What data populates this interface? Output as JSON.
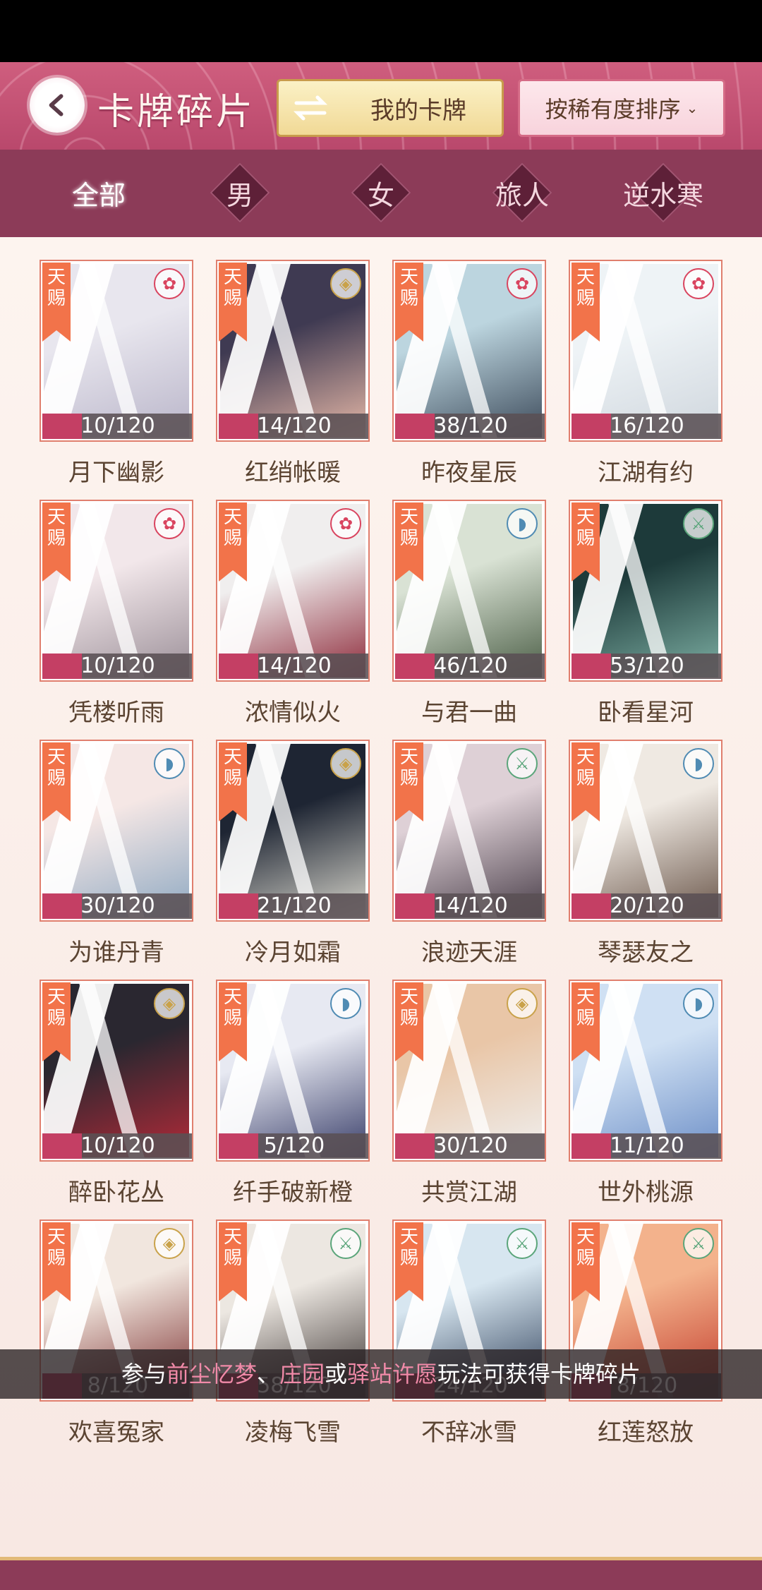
{
  "header": {
    "title": "卡牌碎片",
    "mycards_label": "我的卡牌",
    "sort_label": "按稀有度排序"
  },
  "filters": [
    "全部",
    "男",
    "女",
    "旅人",
    "逆水寒"
  ],
  "active_filter": "全部",
  "colors": {
    "accent": "#c43f64",
    "header": "#cf5e7e",
    "filter_bg": "#8c3b58",
    "tag": "#f2734a"
  },
  "cards": [
    {
      "tag": "天赐",
      "count": "10/120",
      "name": "月下幽影",
      "badge": "flower-icon",
      "art": [
        "#e8e6ee",
        "#b9b5c9"
      ]
    },
    {
      "tag": "天赐",
      "count": "14/120",
      "name": "红绡帐暖",
      "badge": "coin-icon",
      "art": [
        "#3f3a52",
        "#e7b9a8"
      ]
    },
    {
      "tag": "天赐",
      "count": "38/120",
      "name": "昨夜星辰",
      "badge": "flower-icon",
      "art": [
        "#bcd5df",
        "#3c4a5a"
      ]
    },
    {
      "tag": "天赐",
      "count": "16/120",
      "name": "江湖有约",
      "badge": "flower-icon",
      "art": [
        "#eef3f6",
        "#cfd6dd"
      ]
    },
    {
      "tag": "天赐",
      "count": "10/120",
      "name": "凭楼听雨",
      "badge": "flower-icon",
      "art": [
        "#f2e7ea",
        "#9b8f98"
      ]
    },
    {
      "tag": "天赐",
      "count": "14/120",
      "name": "浓情似火",
      "badge": "flower-icon",
      "art": [
        "#f0eeee",
        "#8e2b3b"
      ]
    },
    {
      "tag": "天赐",
      "count": "46/120",
      "name": "与君一曲",
      "badge": "fan-icon",
      "art": [
        "#d9e2d4",
        "#4b5e46"
      ]
    },
    {
      "tag": "天赐",
      "count": "53/120",
      "name": "卧看星河",
      "badge": "sword-icon",
      "art": [
        "#1d3a3a",
        "#7eb0a4"
      ]
    },
    {
      "tag": "天赐",
      "count": "30/120",
      "name": "为谁丹青",
      "badge": "fan-icon",
      "art": [
        "#f5e7e5",
        "#8fa9c2"
      ]
    },
    {
      "tag": "天赐",
      "count": "21/120",
      "name": "冷月如霜",
      "badge": "coin-icon",
      "art": [
        "#1e2533",
        "#d8d6cc"
      ]
    },
    {
      "tag": "天赐",
      "count": "14/120",
      "name": "浪迹天涯",
      "badge": "sword-icon",
      "art": [
        "#ded0d6",
        "#4a3f4a"
      ]
    },
    {
      "tag": "天赐",
      "count": "20/120",
      "name": "琴瑟友之",
      "badge": "fan-icon",
      "art": [
        "#efe9e2",
        "#6b574b"
      ]
    },
    {
      "tag": "天赐",
      "count": "10/120",
      "name": "醉卧花丛",
      "badge": "coin-icon",
      "art": [
        "#2a2730",
        "#b32a38"
      ]
    },
    {
      "tag": "天赐",
      "count": "5/120",
      "name": "纤手破新橙",
      "badge": "fan-icon",
      "art": [
        "#e7e9f2",
        "#3a3f6a"
      ]
    },
    {
      "tag": "天赐",
      "count": "30/120",
      "name": "共赏江湖",
      "badge": "coin-icon",
      "art": [
        "#e9c6a7",
        "#efefef"
      ]
    },
    {
      "tag": "天赐",
      "count": "11/120",
      "name": "世外桃源",
      "badge": "fan-icon",
      "art": [
        "#cfe0f3",
        "#6d8fc7"
      ]
    },
    {
      "tag": "天赐",
      "count": "8/120",
      "name": "欢喜冤家",
      "badge": "coin-icon",
      "art": [
        "#f1e6de",
        "#7b2e2e"
      ]
    },
    {
      "tag": "天赐",
      "count": "58/120",
      "name": "凌梅飞雪",
      "badge": "sword-icon",
      "art": [
        "#ece7e1",
        "#3a3230"
      ]
    },
    {
      "tag": "天赐",
      "count": "24/120",
      "name": "不辞冰雪",
      "badge": "sword-icon",
      "art": [
        "#d7e6f0",
        "#2d3e58"
      ]
    },
    {
      "tag": "天赐",
      "count": "8/120",
      "name": "红莲怒放",
      "badge": "sword-icon",
      "art": [
        "#f3b28c",
        "#c23a2a"
      ]
    }
  ],
  "toast": {
    "p1": "参与",
    "l1": "前尘忆梦",
    "p2": "、",
    "l2": "庄园",
    "p3": "或",
    "l3": "驿站许愿",
    "p4": "玩法可获得卡牌碎片"
  }
}
